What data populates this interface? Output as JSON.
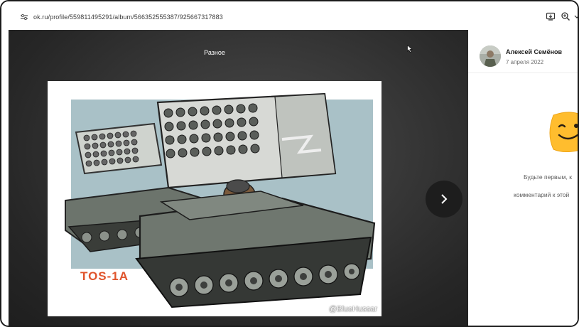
{
  "browser": {
    "url": "ok.ru/profile/559811495291/album/566352555387/925667317883",
    "icons": [
      "site-settings-icon",
      "install-app-icon",
      "zoom-icon"
    ]
  },
  "viewer": {
    "album_title": "Разное",
    "photo": {
      "caption": "TOS-1A",
      "watermark": "@BlueHussar"
    },
    "next_button_icon": "chevron-right-icon"
  },
  "sidebar": {
    "author_name": "Алексей Семёнов",
    "date": "7 апреля 2022",
    "empty_comments": {
      "line1": "Будьте первым, к",
      "line2": "комментарий к этой"
    }
  },
  "colors": {
    "viewer_bg": "#2f2f2f",
    "caption": "#e0542c",
    "sticker": "#ffbd2e"
  }
}
